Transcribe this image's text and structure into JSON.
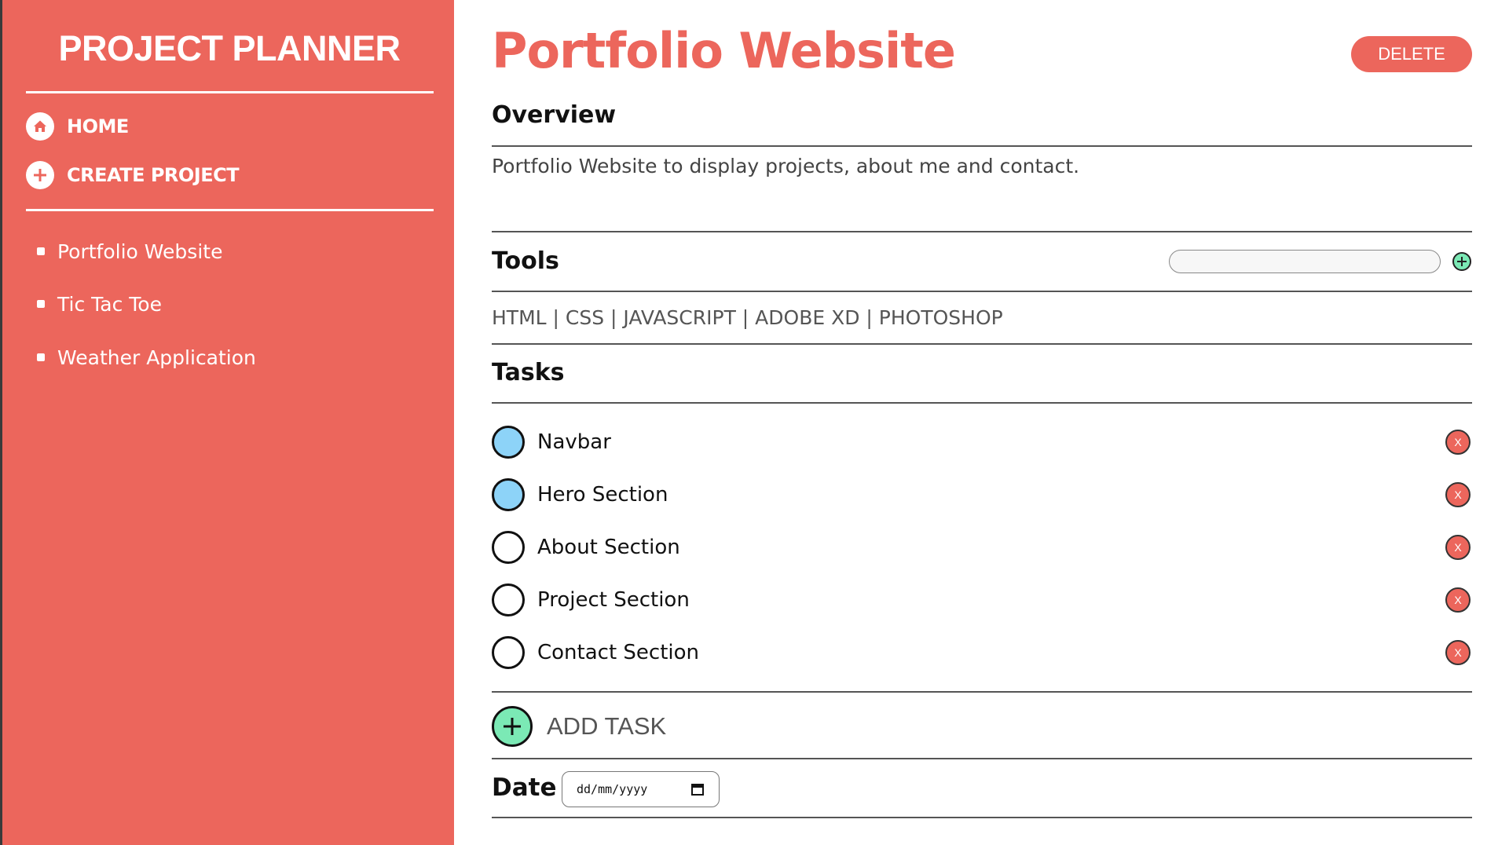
{
  "sidebar": {
    "brand": "PROJECT PLANNER",
    "nav": [
      {
        "label": "HOME",
        "icon": "home-icon"
      },
      {
        "label": "CREATE PROJECT",
        "icon": "plus-circle-icon"
      }
    ],
    "projects": [
      "Portfolio Website",
      "Tic Tac Toe",
      "Weather Application"
    ]
  },
  "main": {
    "title": "Portfolio Website",
    "delete_label": "DELETE",
    "overview": {
      "heading": "Overview",
      "text": "Portfolio Website to display projects, about me and contact."
    },
    "tools": {
      "heading": "Tools",
      "input_value": "",
      "list": "HTML | CSS | JAVASCRIPT | ADOBE XD | PHOTOSHOP"
    },
    "tasks": {
      "heading": "Tasks",
      "items": [
        {
          "label": "Navbar",
          "done": true,
          "delete_label": "X"
        },
        {
          "label": "Hero Section",
          "done": true,
          "delete_label": "X"
        },
        {
          "label": "About Section",
          "done": false,
          "delete_label": "X"
        },
        {
          "label": "Project Section",
          "done": false,
          "delete_label": "X"
        },
        {
          "label": "Contact Section",
          "done": false,
          "delete_label": "X"
        }
      ],
      "add_label": "ADD TASK"
    },
    "date": {
      "label": "Date",
      "placeholder": "dd/mm/yyyy"
    }
  },
  "colors": {
    "accent": "#ec665c",
    "done": "#8dd3f8",
    "add": "#7be9b5"
  }
}
